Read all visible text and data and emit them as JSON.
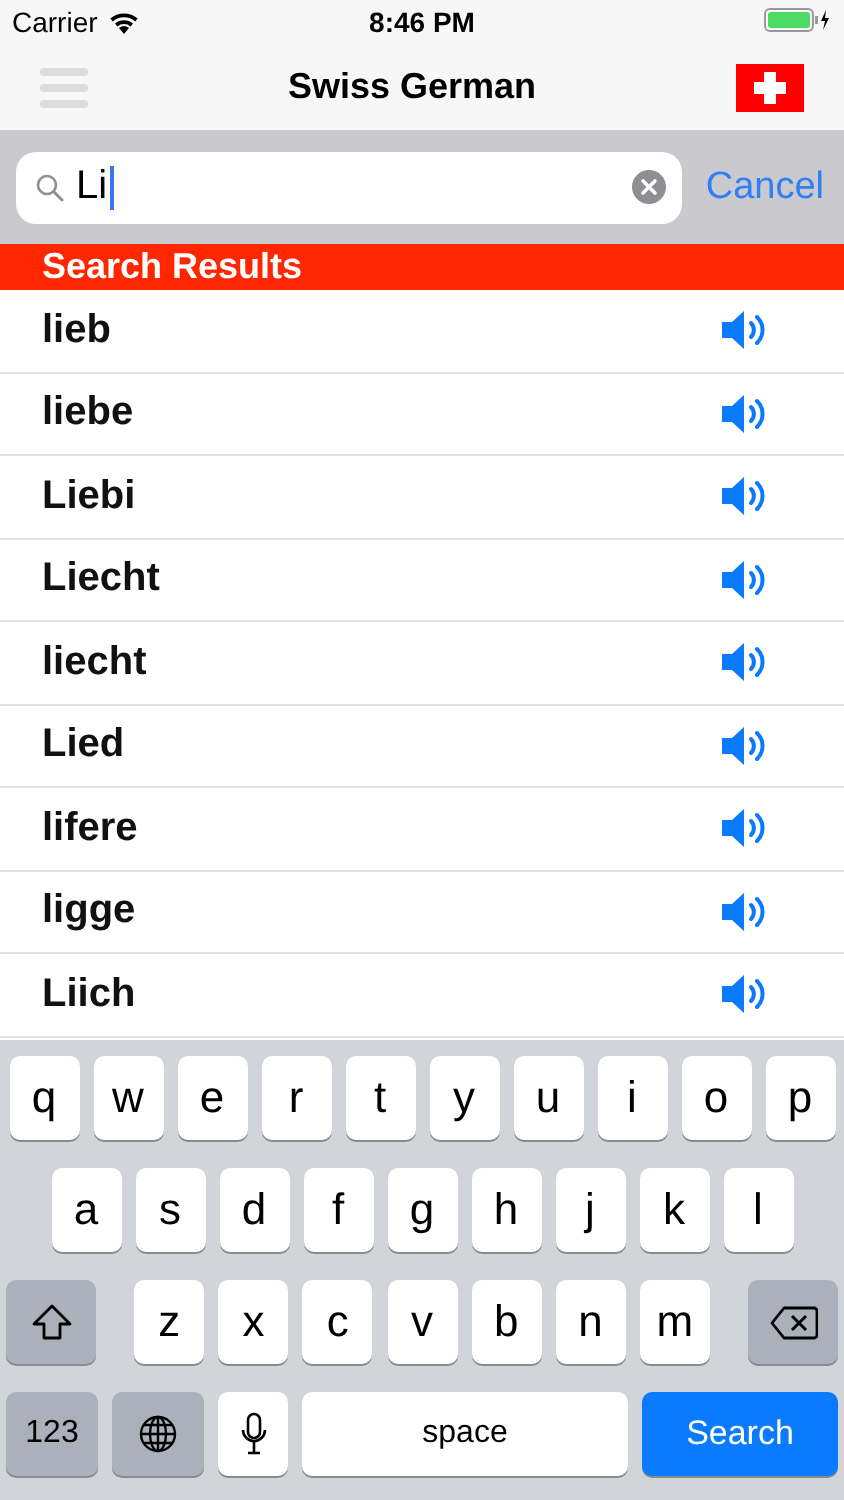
{
  "status_bar": {
    "carrier": "Carrier",
    "time": "8:46 PM"
  },
  "nav_bar": {
    "title": "Swiss German"
  },
  "search": {
    "value": "Li",
    "cancel": "Cancel"
  },
  "section_header": "Search Results",
  "results": [
    {
      "word": "lieb"
    },
    {
      "word": "liebe"
    },
    {
      "word": "Liebi"
    },
    {
      "word": "Liecht"
    },
    {
      "word": "liecht"
    },
    {
      "word": "Lied"
    },
    {
      "word": "lifere"
    },
    {
      "word": "ligge"
    },
    {
      "word": "Liich"
    }
  ],
  "keyboard": {
    "rows": [
      [
        {
          "kind": "letter",
          "label": "q"
        },
        {
          "kind": "letter",
          "label": "w"
        },
        {
          "kind": "letter",
          "label": "e"
        },
        {
          "kind": "letter",
          "label": "r"
        },
        {
          "kind": "letter",
          "label": "t"
        },
        {
          "kind": "letter",
          "label": "y"
        },
        {
          "kind": "letter",
          "label": "u"
        },
        {
          "kind": "letter",
          "label": "i"
        },
        {
          "kind": "letter",
          "label": "o"
        },
        {
          "kind": "letter",
          "label": "p"
        }
      ],
      [
        {
          "kind": "letter",
          "label": "a"
        },
        {
          "kind": "letter",
          "label": "s"
        },
        {
          "kind": "letter",
          "label": "d"
        },
        {
          "kind": "letter",
          "label": "f"
        },
        {
          "kind": "letter",
          "label": "g"
        },
        {
          "kind": "letter",
          "label": "h"
        },
        {
          "kind": "letter",
          "label": "j"
        },
        {
          "kind": "letter",
          "label": "k"
        },
        {
          "kind": "letter",
          "label": "l"
        }
      ],
      [
        {
          "kind": "shift"
        },
        {
          "kind": "letter",
          "label": "z"
        },
        {
          "kind": "letter",
          "label": "x"
        },
        {
          "kind": "letter",
          "label": "c"
        },
        {
          "kind": "letter",
          "label": "v"
        },
        {
          "kind": "letter",
          "label": "b"
        },
        {
          "kind": "letter",
          "label": "n"
        },
        {
          "kind": "letter",
          "label": "m"
        },
        {
          "kind": "delete"
        }
      ]
    ],
    "bottom_bar": [
      {
        "kind": "numbers",
        "label": "123"
      },
      {
        "kind": "globe"
      },
      {
        "kind": "mic"
      },
      {
        "kind": "space",
        "label": "space"
      },
      {
        "kind": "search",
        "label": "Search"
      }
    ]
  }
}
